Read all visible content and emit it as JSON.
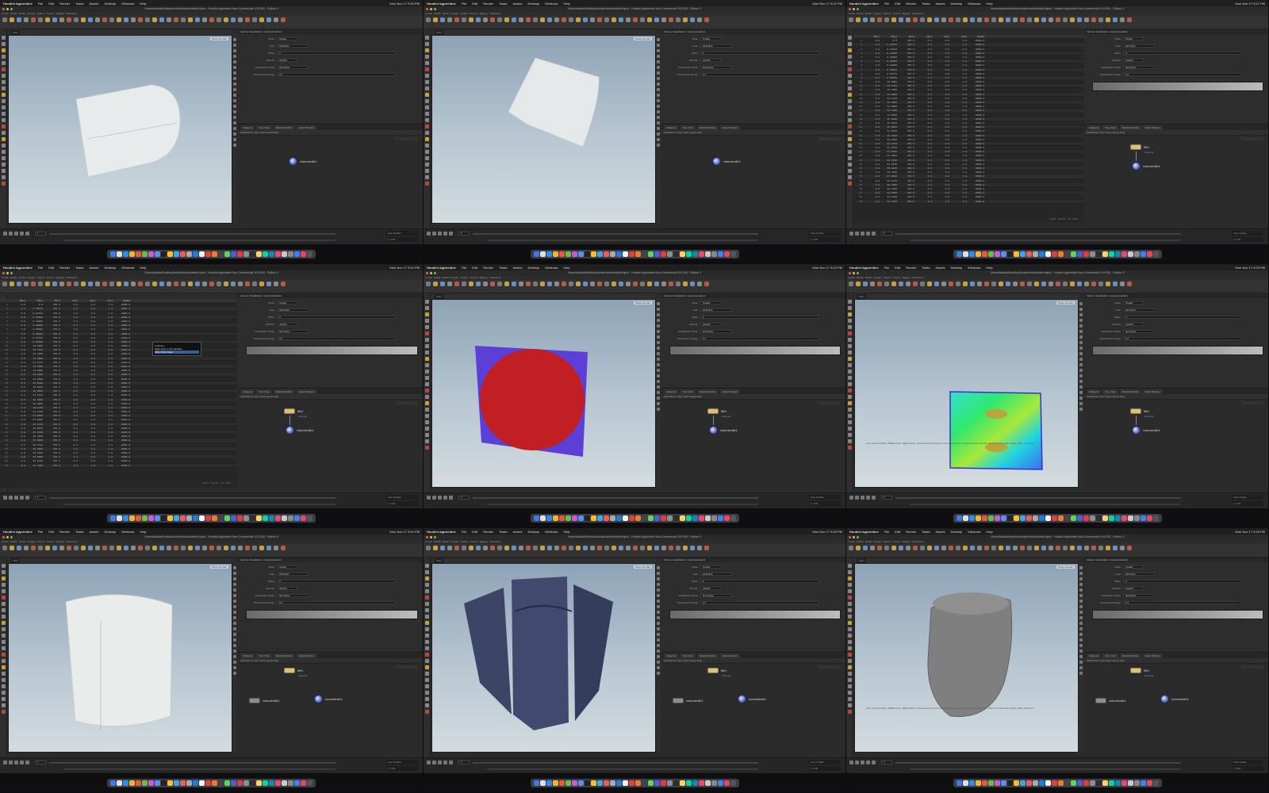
{
  "menubar": {
    "app": "Houdini Apprentice",
    "items": [
      "File",
      "Edit",
      "Render",
      "Tasks",
      "Assets",
      "Desktop",
      "Windows",
      "Help"
    ],
    "clocks": [
      "Mon Nov 17 9:20 PM",
      "Mon Nov 17 9:21 PM",
      "Mon Nov 17 9:21 PM",
      "Mon Nov 17 9:22 PM",
      "Mon Nov 17 9:23 PM",
      "Mon Nov 17 9:23 PM",
      "Mon Nov 17 9:24 PM",
      "Mon Nov 17 9:25 PM",
      "Mon Nov 17 9:25 PM"
    ]
  },
  "window": {
    "title": "/Users/kanika/Desktop/houdini/work/untitled.hipnc - Houdini Apprentice Non-Commercial 19.5.303 - Python 3"
  },
  "shelf_tabs": [
    "Create",
    "Modify",
    "Model",
    "Polygon",
    "Deform",
    "Texture",
    "Rigging",
    "Characters"
  ],
  "viewport": {
    "label": "View",
    "camera": "Persp",
    "cam2": "No cam",
    "status_note": "Left mouse tumbles. Middle pans. Right dollies. Ctrl+Alt+Left box-zooms. Ctrl+Right zooms. Spacebar-Ctrl-Left tilts. Hold L for alternate tumble, dolly, and zoom."
  },
  "params_panel": {
    "tab": "Volume Visualization: volumevisualize1",
    "rows": [
      {
        "label": "Mode",
        "value": "Smoke"
      },
      {
        "label": "Input",
        "value": "All Points"
      },
      {
        "label": "Offset",
        "value": "0"
      },
      {
        "label": "Attribute",
        "value": "velocity"
      },
      {
        "label": "Visualization Mode",
        "value": "Not Active"
      },
      {
        "label": "Visualization Range",
        "value": "0.1"
      }
    ],
    "ramp_label": "Color Ramp",
    "checkbox": "Keep Original Attributes"
  },
  "network": {
    "tabs": [
      "/obj/geo1",
      "Tree View",
      "Material Palette",
      "Asset Browser"
    ],
    "bar": "Add  Edit  Go  View  Tools  Layout  Help",
    "context": "Geometry",
    "nodes": {
      "file": "file1",
      "file_sub": "body.obj",
      "volume": "volumevdb1",
      "convert": "convertvdb1"
    }
  },
  "spreadsheet": {
    "headers": [
      "",
      "P[x]",
      "P[y]",
      "P[z]",
      "v[x]",
      "v[y]",
      "v[z]",
      "Alpha"
    ],
    "rows": [
      [
        "0",
        "0.0",
        "0.0",
        "251.5",
        "0.2",
        "0.0",
        "1.8",
        "-9999.0"
      ],
      [
        "1",
        "0.0",
        "3.70574",
        "251.5",
        "0.2",
        "0.0",
        "1.8",
        "-9999.0"
      ],
      [
        "2",
        "0.0",
        "0.87812",
        "251.5",
        "0.2",
        "0.0",
        "1.8",
        "-9999.0"
      ],
      [
        "3",
        "0.0",
        "0.18093",
        "251.5",
        "0.2",
        "0.0",
        "1.8",
        "-9999.0"
      ],
      [
        "4",
        "0.0",
        "0.44993",
        "251.5",
        "0.2",
        "0.0",
        "1.8",
        "-9999.0"
      ],
      [
        "5",
        "0.0",
        "0.68000",
        "251.5",
        "0.2",
        "0.0",
        "1.8",
        "-9999.0"
      ],
      [
        "6",
        "0.0",
        "0.68000",
        "251.5",
        "0.2",
        "0.0",
        "1.8",
        "-9999.0"
      ],
      [
        "7",
        "0.0",
        "0.45911",
        "251.5",
        "0.2",
        "0.0",
        "1.8",
        "-9999.0"
      ],
      [
        "8",
        "0.0",
        "6.67970",
        "251.5",
        "0.2",
        "0.0",
        "1.8",
        "-9999.0"
      ],
      [
        "9",
        "0.0",
        "6.65500",
        "251.5",
        "0.2",
        "0.0",
        "1.8",
        "-9999.0"
      ],
      [
        "10",
        "0.0",
        "10.0000",
        "251.5",
        "0.2",
        "0.0",
        "1.8",
        "-9999.0"
      ],
      [
        "11",
        "0.0",
        "10.1191",
        "251.5",
        "0.2",
        "0.0",
        "1.8",
        "-9999.0"
      ],
      [
        "12",
        "0.0",
        "10.3395",
        "251.5",
        "0.2",
        "0.0",
        "1.8",
        "-9999.0"
      ],
      [
        "13",
        "0.0",
        "11.9880",
        "251.5",
        "0.2",
        "0.0",
        "1.8",
        "-9999.0"
      ],
      [
        "14",
        "0.0",
        "12.1170",
        "251.5",
        "0.2",
        "0.0",
        "1.8",
        "-9999.0"
      ],
      [
        "15",
        "0.0",
        "12.3800",
        "251.5",
        "0.2",
        "0.0",
        "1.8",
        "-9999.0"
      ],
      [
        "16",
        "0.0",
        "12.9690",
        "251.5",
        "0.2",
        "0.0",
        "1.8",
        "-9999.0"
      ],
      [
        "17",
        "0.0",
        "14.1300",
        "251.5",
        "0.2",
        "0.0",
        "1.8",
        "-9999.0"
      ],
      [
        "18",
        "0.0",
        "14.2690",
        "251.5",
        "0.2",
        "0.0",
        "1.8",
        "-9999.0"
      ],
      [
        "19",
        "0.0",
        "15.0020",
        "251.5",
        "0.2",
        "0.0",
        "1.8",
        "-9999.0"
      ],
      [
        "20",
        "0.0",
        "15.6070",
        "251.5",
        "0.2",
        "0.0",
        "1.8",
        "-9999.0"
      ],
      [
        "21",
        "0.0",
        "16.0950",
        "251.5",
        "0.2",
        "0.0",
        "1.8",
        "-9999.0"
      ],
      [
        "22",
        "0.0",
        "17.5440",
        "251.5",
        "0.2",
        "0.0",
        "1.8",
        "-9999.0"
      ],
      [
        "23",
        "0.0",
        "18.3040",
        "251.5",
        "0.2",
        "0.0",
        "1.8",
        "-9999.0"
      ],
      [
        "24",
        "0.0",
        "19.0000",
        "251.5",
        "0.2",
        "0.0",
        "1.8",
        "-9999.0"
      ],
      [
        "25",
        "0.0",
        "20.1210",
        "251.5",
        "0.2",
        "0.0",
        "1.8",
        "-9999.0"
      ],
      [
        "26",
        "0.0",
        "21.2720",
        "251.5",
        "0.2",
        "0.0",
        "1.8",
        "-9999.0"
      ],
      [
        "27",
        "0.0",
        "21.9630",
        "251.5",
        "0.2",
        "0.0",
        "1.8",
        "-9999.0"
      ],
      [
        "28",
        "0.0",
        "22.8880",
        "251.5",
        "0.2",
        "0.0",
        "1.8",
        "-9999.0"
      ],
      [
        "29",
        "0.0",
        "23.1740",
        "251.5",
        "0.2",
        "0.0",
        "1.8",
        "-9999.0"
      ],
      [
        "30",
        "0.0",
        "24.0570",
        "251.5",
        "0.2",
        "0.0",
        "1.8",
        "-9999.0"
      ],
      [
        "31",
        "0.0",
        "25.8120",
        "251.5",
        "0.2",
        "0.0",
        "1.8",
        "-9999.0"
      ],
      [
        "32",
        "0.0",
        "26.3520",
        "251.5",
        "0.2",
        "0.0",
        "1.8",
        "-9999.0"
      ],
      [
        "33",
        "0.0",
        "27.0680",
        "251.5",
        "0.2",
        "0.0",
        "1.8",
        "-9999.0"
      ],
      [
        "34",
        "0.0",
        "28.2710",
        "251.5",
        "0.2",
        "0.0",
        "1.8",
        "-9999.0"
      ],
      [
        "35",
        "0.0",
        "29.8560",
        "251.5",
        "0.2",
        "0.0",
        "1.8",
        "-9999.0"
      ],
      [
        "36",
        "0.0",
        "30.1260",
        "251.5",
        "0.2",
        "0.0",
        "1.8",
        "-9999.0"
      ],
      [
        "37",
        "0.0",
        "31.5590",
        "251.5",
        "0.2",
        "0.0",
        "1.8",
        "-9999.0"
      ],
      [
        "38",
        "0.0",
        "32.1220",
        "251.5",
        "0.2",
        "0.0",
        "1.8",
        "-9999.0"
      ],
      [
        "39",
        "0.0",
        "33.7460",
        "251.5",
        "0.2",
        "0.0",
        "1.8",
        "-9999.0"
      ]
    ],
    "footer": "Point Count: 15 7424",
    "popup": [
      "Columns",
      "Right-click on the attribute",
      "Show Point Index"
    ]
  },
  "timeline": {
    "frame": "1",
    "start": "1",
    "end": "240",
    "key": "Auto Update"
  },
  "colors": {
    "viewport_top": "#8ea3b6",
    "viewport_bottom": "#d3dcde",
    "red_disc": "#c21f24",
    "purple_plane": "#5b3fd6",
    "dark_blue_shell": "#3b4466",
    "node_yellow": "#d9c07c"
  },
  "dock_colors": [
    "#3f7be8",
    "#e0e0e0",
    "#2d8cf0",
    "#f3b32c",
    "#e8583c",
    "#6abe45",
    "#c95bd6",
    "#5a8ff0",
    "#222",
    "#fcbf2b",
    "#3aa7e9",
    "#f05a5a",
    "#aaa",
    "#1e7de1",
    "#f2f2f2",
    "#d9433b",
    "#ee7c2b",
    "#444",
    "#5cd65c",
    "#4c5fd7",
    "#e63946",
    "#8e8e8e",
    "#2d2d2d",
    "#ffd166",
    "#06d6a0",
    "#118ab2",
    "#ef476f",
    "#c9c9c9",
    "#888",
    "#3b82f6",
    "#e94560",
    "#555"
  ]
}
